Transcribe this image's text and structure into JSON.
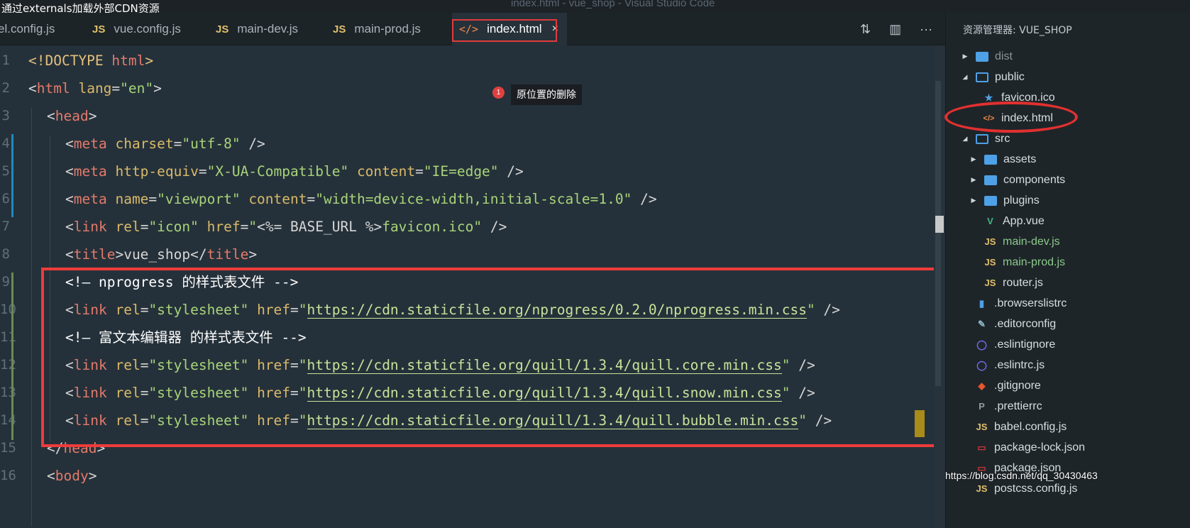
{
  "window": {
    "overlay_title": "通过externals加载外部CDN资源",
    "app_title": "index.html - vue_shop - Visual Studio Code"
  },
  "tabs": [
    {
      "icon": "js-icon",
      "label": "el.config.js"
    },
    {
      "icon": "js-icon",
      "label": "vue.config.js"
    },
    {
      "icon": "js-icon",
      "label": "main-dev.js"
    },
    {
      "icon": "js-icon",
      "label": "main-prod.js"
    },
    {
      "icon": "html-icon",
      "label": "index.html",
      "active": true
    }
  ],
  "tab_labels": {
    "js": "JS",
    "html": "</>",
    "close": "×"
  },
  "tab_actions": {
    "compare": "⇅",
    "split": "▥",
    "more": "···"
  },
  "annotation": {
    "badge": "1",
    "text": "原位置的删除"
  },
  "editor": {
    "line_numbers": [
      "1",
      "2",
      "3",
      "4",
      "5",
      "6",
      "7",
      "8",
      "9",
      "10",
      "11",
      "12",
      "13",
      "14",
      "15",
      "16"
    ]
  },
  "explorer": {
    "title": "资源管理器: VUE_SHOP",
    "items": [
      {
        "name": "dist",
        "kind": "folder",
        "arrow": "▶"
      },
      {
        "name": "public",
        "kind": "folder-open",
        "arrow": "◢"
      },
      {
        "name": "favicon.ico",
        "kind": "file",
        "glyph": "★"
      },
      {
        "name": "index.html",
        "kind": "file",
        "glyph": "</>"
      },
      {
        "name": "src",
        "kind": "folder-open",
        "arrow": "◢"
      },
      {
        "name": "assets",
        "kind": "folder",
        "arrow": "▶"
      },
      {
        "name": "components",
        "kind": "folder",
        "arrow": "▶"
      },
      {
        "name": "plugins",
        "kind": "folder",
        "arrow": "▶"
      },
      {
        "name": "App.vue",
        "kind": "file",
        "glyph": "V"
      },
      {
        "name": "main-dev.js",
        "kind": "file",
        "glyph": "JS"
      },
      {
        "name": "main-prod.js",
        "kind": "file",
        "glyph": "JS"
      },
      {
        "name": "router.js",
        "kind": "file",
        "glyph": "JS"
      },
      {
        "name": ".browserslistrc",
        "kind": "file",
        "glyph": "▮"
      },
      {
        "name": ".editorconfig",
        "kind": "file",
        "glyph": "✎"
      },
      {
        "name": ".eslintignore",
        "kind": "file",
        "glyph": "◯"
      },
      {
        "name": ".eslintrc.js",
        "kind": "file",
        "glyph": "◯"
      },
      {
        "name": ".gitignore",
        "kind": "file",
        "glyph": "◆"
      },
      {
        "name": ".prettierrc",
        "kind": "file",
        "glyph": "P"
      },
      {
        "name": "babel.config.js",
        "kind": "file",
        "glyph": "JS"
      },
      {
        "name": "package-lock.json",
        "kind": "file",
        "glyph": "▭"
      },
      {
        "name": "package.json",
        "kind": "file",
        "glyph": "▭"
      },
      {
        "name": "postcss.config.js",
        "kind": "file",
        "glyph": "JS"
      }
    ]
  },
  "watermark": "https://blog.csdn.net/qq_30430463",
  "code": {
    "l1": {
      "open": "<!DOCTYPE",
      "name": " html",
      "close": ">"
    },
    "l2": {
      "open": "<",
      "tag": "html",
      "attr": " lang",
      "eq": "=",
      "val": "\"en\"",
      "close": ">"
    },
    "l3": {
      "open": "<",
      "tag": "head",
      "close": ">"
    },
    "l4": {
      "open": "<",
      "tag": "meta",
      "attr": " charset",
      "eq": "=",
      "val": "\"utf-8\"",
      "close": " />"
    },
    "l5": {
      "open": "<",
      "tag": "meta",
      "attr1": " http-equiv",
      "eq": "=",
      "val1": "\"X-UA-Compatible\"",
      "attr2": " content",
      "val2": "\"IE=edge\"",
      "close": " />"
    },
    "l6": {
      "open": "<",
      "tag": "meta",
      "attr1": " name",
      "eq": "=",
      "val1": "\"viewport\"",
      "attr2": " content",
      "val2": "\"width=device-width,initial-scale=1.0\"",
      "close": " />"
    },
    "l7": {
      "open": "<",
      "tag": "link",
      "attr1": " rel",
      "eq": "=",
      "val1": "\"icon\"",
      "attr2": " href",
      "val2a": "\"",
      "tpl": "<%= BASE_URL %>",
      "val2b": "favicon.ico\"",
      "close": " />"
    },
    "l8": {
      "open": "<",
      "tag": "title",
      "gt": ">",
      "text": "vue_shop",
      "endopen": "</",
      "endtag": "title",
      "close": ">"
    },
    "l9": {
      "comment": "<!– nprogress 的样式表文件 -->"
    },
    "l10": {
      "open": "<",
      "tag": "link",
      "attr1": " rel",
      "eq": "=",
      "val1": "\"stylesheet\"",
      "attr2": " href",
      "q": "\"",
      "url": "https://cdn.staticfile.org/nprogress/0.2.0/nprogress.min.css",
      "close": " />"
    },
    "l11": {
      "comment": "<!– 富文本编辑器 的样式表文件 -->"
    },
    "l12": {
      "open": "<",
      "tag": "link",
      "attr1": " rel",
      "eq": "=",
      "val1": "\"stylesheet\"",
      "attr2": " href",
      "q": "\"",
      "url": "https://cdn.staticfile.org/quill/1.3.4/quill.core.min.css",
      "close": " />"
    },
    "l13": {
      "open": "<",
      "tag": "link",
      "attr1": " rel",
      "eq": "=",
      "val1": "\"stylesheet\"",
      "attr2": " href",
      "q": "\"",
      "url": "https://cdn.staticfile.org/quill/1.3.4/quill.snow.min.css",
      "close": " />"
    },
    "l14": {
      "open": "<",
      "tag": "link",
      "attr1": " rel",
      "eq": "=",
      "val1": "\"stylesheet\"",
      "attr2": " href",
      "q": "\"",
      "url": "https://cdn.staticfile.org/quill/1.3.4/quill.bubble.min.css",
      "close": " />"
    },
    "l15": {
      "open": "</",
      "tag": "head",
      "close": ">"
    },
    "l16": {
      "open": "<",
      "tag": "body",
      "close": ">"
    }
  }
}
